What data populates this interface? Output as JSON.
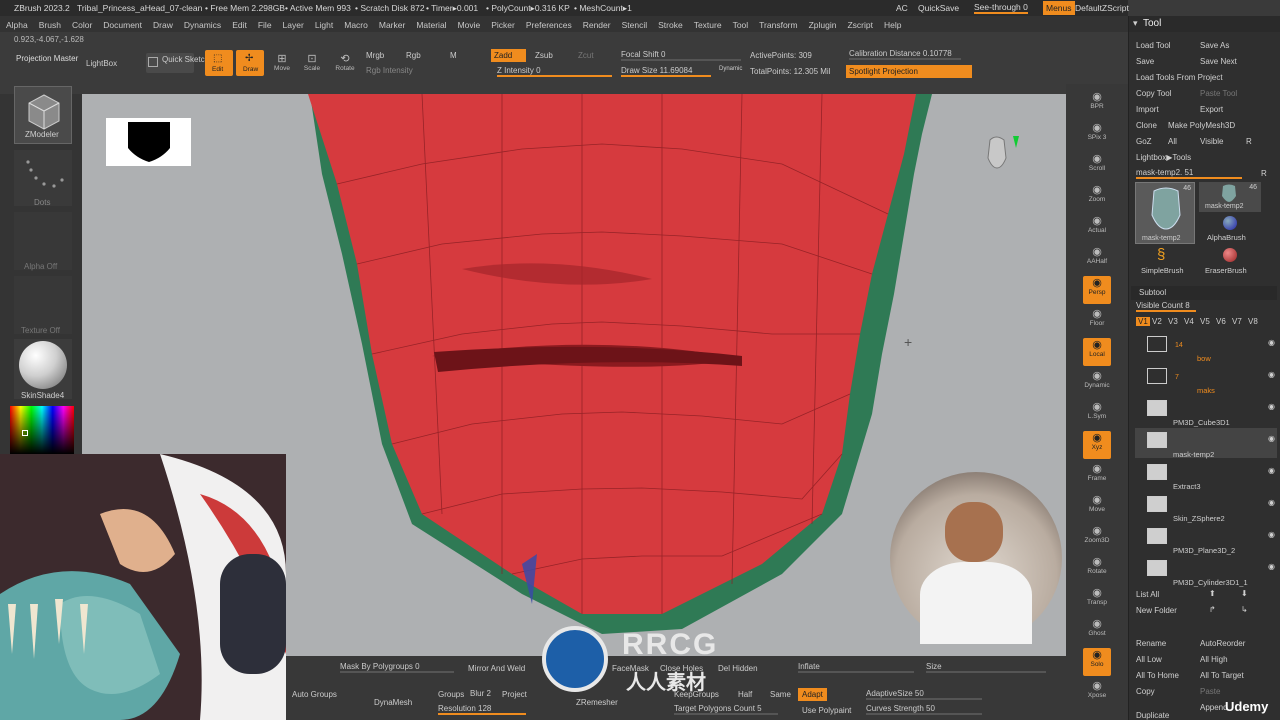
{
  "topbar": {
    "app": "ZBrush 2023.2",
    "doc": "Tribal_Princess_aHead_07-clean",
    "free_mem": "• Free Mem 2.298GB",
    "active_mem": "• Active Mem 993",
    "scratch": "• Scratch Disk 872",
    "timer": "• Timer▸0.001",
    "polycount": "• PolyCount▸0.316 KP",
    "meshcount": "• MeshCount▸1",
    "ac": "AC",
    "quicksave": "QuickSave",
    "seethrough": "See-through  0",
    "menus": "Menus",
    "script": "DefaultZScript"
  },
  "menu": [
    "Alpha",
    "Brush",
    "Color",
    "Document",
    "Draw",
    "Dynamics",
    "Edit",
    "File",
    "Layer",
    "Light",
    "Macro",
    "Marker",
    "Material",
    "Movie",
    "Picker",
    "Preferences",
    "Render",
    "Stencil",
    "Stroke",
    "Texture",
    "Tool",
    "Transform",
    "Zplugin",
    "Zscript",
    "Help"
  ],
  "coords": "0.923,-4.067,-1.628",
  "shelf": {
    "projection_master": "Projection Master",
    "lightbox": "LightBox",
    "quick_sketch": "Quick Sketch",
    "edit": "Edit",
    "draw": "Draw",
    "move": "Move",
    "scale": "Scale",
    "rotate": "Rotate",
    "mrgb": "Mrgb",
    "rgb": "Rgb",
    "m": "M",
    "rgb_intensity": "Rgb Intensity",
    "zadd": "Zadd",
    "zsub": "Zsub",
    "zcut": "Zcut",
    "z_intensity": "Z Intensity 0",
    "focal_shift": "Focal Shift 0",
    "draw_size": "Draw Size 11.69084",
    "dynamic": "Dynamic",
    "active_points": "ActivePoints: 309",
    "total_points": "TotalPoints: 12.305 Mil",
    "calibration": "Calibration Distance 0.10778",
    "spotlight": "Spotlight Projection"
  },
  "left": {
    "zmodeler": "ZModeler",
    "dots": "Dots",
    "alpha": "Alpha Off",
    "texture": "Texture Off",
    "material": "SkinShade4"
  },
  "right_icons": [
    "BPR",
    "SPix 3",
    "Scroll",
    "Zoom",
    "Actual",
    "AAHalf",
    "Persp",
    "Floor",
    "Local",
    "Dynamic",
    "L.Sym",
    "Xyz",
    "Frame",
    "Move",
    "Zoom3D",
    "Rotate",
    "Transp",
    "Ghost",
    "Solo",
    "Xpose"
  ],
  "tool": {
    "title": "Tool",
    "load_tool": "Load Tool",
    "save_as": "Save As",
    "save": "Save",
    "save_next": "Save Next",
    "load_from_project": "Load Tools From Project",
    "copy_tool": "Copy Tool",
    "paste_tool": "Paste Tool",
    "import": "Import",
    "export": "Export",
    "clone": "Clone",
    "make_polymesh": "Make PolyMesh3D",
    "goz": "GoZ",
    "all": "All",
    "visible": "Visible",
    "r": "R",
    "lightbox_tools": "Lightbox▶Tools",
    "mask_temp_slider": "mask-temp2. 51",
    "thumbs": [
      {
        "label": "mask-temp2",
        "count": "46"
      },
      {
        "label": "mask-temp2",
        "count": "46"
      },
      {
        "label": "AlphaBrush",
        "count": ""
      },
      {
        "label": "SimpleBrush",
        "count": ""
      },
      {
        "label": "EraserBrush",
        "count": ""
      }
    ],
    "subtool": "Subtool",
    "visible_count": "Visible Count 8",
    "versions": [
      "V1",
      "V2",
      "V3",
      "V4",
      "V5",
      "V6",
      "V7",
      "V8"
    ],
    "items": [
      {
        "name": "bow",
        "num": "14",
        "folder": true
      },
      {
        "name": "maks",
        "num": "7",
        "folder": true
      },
      {
        "name": "PM3D_Cube3D1",
        "num": "",
        "folder": false
      },
      {
        "name": "mask-temp2",
        "num": "",
        "folder": false
      },
      {
        "name": "Extract3",
        "num": "",
        "folder": false
      },
      {
        "name": "Skin_ZSphere2",
        "num": "",
        "folder": false
      },
      {
        "name": "PM3D_Plane3D_2",
        "num": "",
        "folder": false
      },
      {
        "name": "PM3D_Cylinder3D1_1",
        "num": "",
        "folder": false
      }
    ],
    "list_all": "List All",
    "new_folder": "New Folder",
    "rename": "Rename",
    "autoreorder": "AutoReorder",
    "all_low": "All Low",
    "all_high": "All High",
    "all_to_home": "All To Home",
    "all_to_target": "All To Target",
    "copy": "Copy",
    "paste": "Paste",
    "duplicate": "Duplicate",
    "append": "Append"
  },
  "bottom": {
    "mask_by_polygroups": "Mask By Polygroups 0",
    "mirror_and_weld": "Mirror And Weld",
    "facemask": "FaceMask",
    "close_holes": "Close Holes",
    "del_hidden": "Del Hidden",
    "inflate": "Inflate",
    "size": "Size",
    "auto_groups": "Auto Groups",
    "dynamesh": "DynaMesh",
    "groups": "Groups",
    "blur": "Blur 2",
    "project": "Project",
    "resolution": "Resolution 128",
    "zremesher": "ZRemesher",
    "keepgroups": "KeepGroups",
    "half": "Half",
    "same": "Same",
    "adapt": "Adapt",
    "target_polygons": "Target Polygons Count 5",
    "use_polypaint": "Use Polypaint",
    "adaptive_size": "AdaptiveSize 50",
    "curves_strength": "Curves Strength 50"
  },
  "watermark": {
    "brand": "RRCG",
    "sub": "人人素材",
    "udemy": "Udemy"
  },
  "colors": {
    "accent": "#f08c1e",
    "mesh": "#d63a3e",
    "rim": "#2f7a55",
    "viewport": "#aeb0b2"
  }
}
